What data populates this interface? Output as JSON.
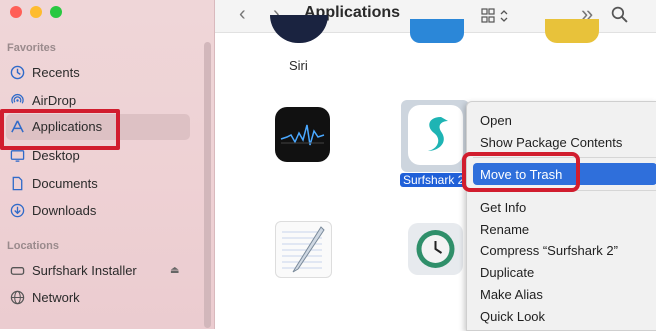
{
  "window": {
    "title": "Applications"
  },
  "sidebar": {
    "favorites_heading": "Favorites",
    "items": [
      {
        "label": "Recents",
        "icon": "clock-icon"
      },
      {
        "label": "AirDrop",
        "icon": "airdrop-icon"
      },
      {
        "label": "Applications",
        "icon": "applications-icon",
        "selected": true
      },
      {
        "label": "Desktop",
        "icon": "desktop-icon"
      },
      {
        "label": "Documents",
        "icon": "document-icon"
      },
      {
        "label": "Downloads",
        "icon": "downloads-icon"
      }
    ],
    "locations_heading": "Locations",
    "locations": [
      {
        "label": "Surfshark Installer",
        "icon": "disk-icon",
        "eject": "⏏"
      },
      {
        "label": "Network",
        "icon": "network-icon"
      }
    ]
  },
  "toolbar": {
    "back": "‹",
    "forward": "›",
    "more": "»"
  },
  "content": {
    "siri_label": "Siri",
    "selected_app_label": "Surfshark 2"
  },
  "context_menu": {
    "items": [
      "Open",
      "Show Package Contents",
      "Move to Trash",
      "Get Info",
      "Rename",
      "Compress “Surfshark 2”",
      "Duplicate",
      "Make Alias",
      "Quick Look"
    ],
    "highlighted": "Move to Trash"
  },
  "colors": {
    "highlight": "#d11d2e",
    "selection": "#2f6fdb",
    "surfshark": "#1eb4b4"
  }
}
